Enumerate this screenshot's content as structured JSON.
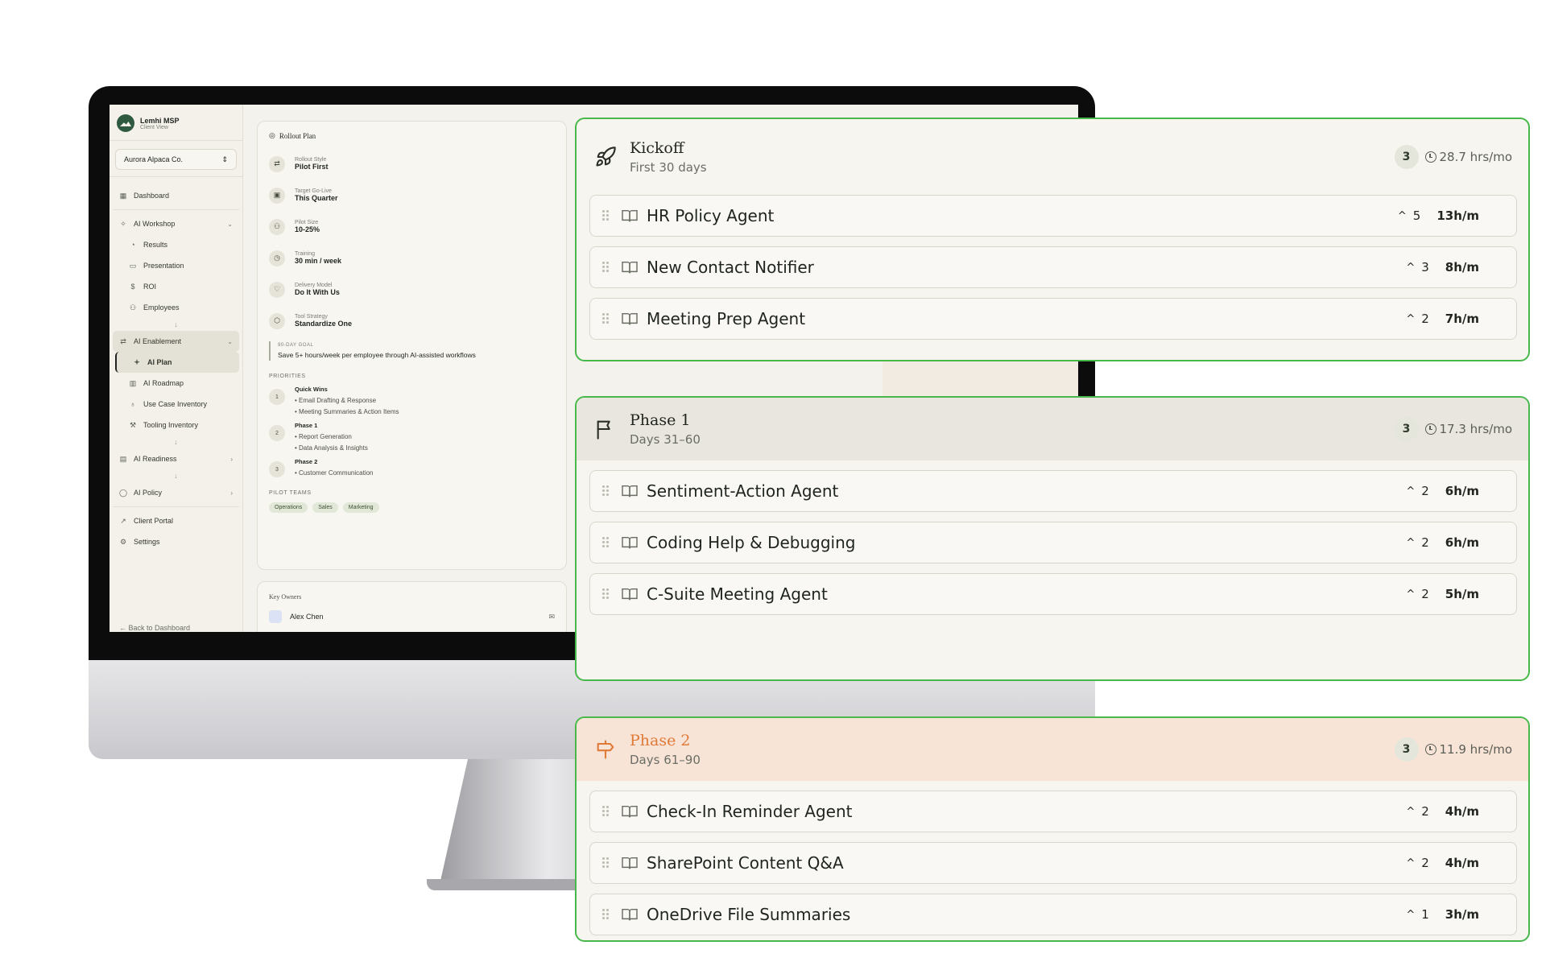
{
  "app": {
    "brand_name": "Lemhi MSP",
    "brand_sub": "Client View",
    "client_selector": "Aurora Alpaca Co.",
    "back_link": "Back to Dashboard"
  },
  "sidebar": {
    "items": [
      {
        "label": "Dashboard",
        "icon": "grid-icon"
      },
      {
        "label": "AI Workshop",
        "icon": "workshop-icon"
      },
      {
        "label": "Results",
        "icon": "chart-icon"
      },
      {
        "label": "Presentation",
        "icon": "presentation-icon"
      },
      {
        "label": "ROI",
        "icon": "dollar-icon"
      },
      {
        "label": "Employees",
        "icon": "users-icon"
      },
      {
        "label": "AI Enablement",
        "icon": "enablement-icon"
      },
      {
        "label": "AI Plan",
        "icon": "plan-icon"
      },
      {
        "label": "AI Roadmap",
        "icon": "map-icon"
      },
      {
        "label": "Use Case Inventory",
        "icon": "bulb-icon"
      },
      {
        "label": "Tooling Inventory",
        "icon": "wrench-icon"
      },
      {
        "label": "AI Readiness",
        "icon": "readiness-icon"
      },
      {
        "label": "AI Policy",
        "icon": "shield-icon"
      },
      {
        "label": "Client Portal",
        "icon": "external-icon"
      },
      {
        "label": "Settings",
        "icon": "gear-icon"
      }
    ]
  },
  "rollout": {
    "title": "Rollout Plan",
    "rows": [
      {
        "label": "Rollout Style",
        "value": "Pilot First"
      },
      {
        "label": "Target Go-Live",
        "value": "This Quarter"
      },
      {
        "label": "Pilot Size",
        "value": "10-25%"
      },
      {
        "label": "Training",
        "value": "30 min / week"
      },
      {
        "label": "Delivery Model",
        "value": "Do It With Us"
      },
      {
        "label": "Tool Strategy",
        "value": "Standardize One"
      }
    ],
    "goal_label": "90-DAY GOAL",
    "goal_text": "Save 5+ hours/week per employee through AI-assisted workflows",
    "priorities_label": "PRIORITIES",
    "priorities": [
      {
        "num": "1",
        "phase": "Quick Wins",
        "items": [
          "• Email Drafting & Response",
          "• Meeting Summaries & Action Items"
        ]
      },
      {
        "num": "2",
        "phase": "Phase 1",
        "items": [
          "• Report Generation",
          "• Data Analysis & Insights"
        ]
      },
      {
        "num": "3",
        "phase": "Phase 2",
        "items": [
          "• Customer Communication"
        ]
      }
    ],
    "pilot_teams_label": "PILOT TEAMS",
    "pilot_teams": [
      "Operations",
      "Sales",
      "Marketing"
    ]
  },
  "owners": {
    "title": "Key Owners",
    "name": "Alex Chen"
  },
  "phases": {
    "kickoff": {
      "name": "Kickoff",
      "sub": "First 30 days",
      "count": "3",
      "hours": "28.7 hrs/mo",
      "agents": [
        {
          "name": "HR Policy Agent",
          "votes": "5",
          "hours": "13h/m"
        },
        {
          "name": "New Contact Notifier",
          "votes": "3",
          "hours": "8h/m"
        },
        {
          "name": "Meeting Prep Agent",
          "votes": "2",
          "hours": "7h/m"
        }
      ]
    },
    "phase1": {
      "name": "Phase 1",
      "sub": "Days 31–60",
      "count": "3",
      "hours": "17.3 hrs/mo",
      "agents": [
        {
          "name": "Sentiment-Action Agent",
          "votes": "2",
          "hours": "6h/m"
        },
        {
          "name": "Coding Help & Debugging",
          "votes": "2",
          "hours": "6h/m"
        },
        {
          "name": "C-Suite Meeting Agent",
          "votes": "2",
          "hours": "5h/m"
        }
      ]
    },
    "phase2": {
      "name": "Phase 2",
      "sub": "Days 61–90",
      "count": "3",
      "hours": "11.9 hrs/mo",
      "agents": [
        {
          "name": "Check-In Reminder Agent",
          "votes": "2",
          "hours": "4h/m"
        },
        {
          "name": "SharePoint Content Q&A",
          "votes": "2",
          "hours": "4h/m"
        },
        {
          "name": "OneDrive File Summaries",
          "votes": "1",
          "hours": "3h/m"
        }
      ]
    }
  },
  "colors": {
    "accent_green": "#48b84a",
    "phase2_orange": "#e07a38",
    "brand_green": "#2f5a3f"
  }
}
